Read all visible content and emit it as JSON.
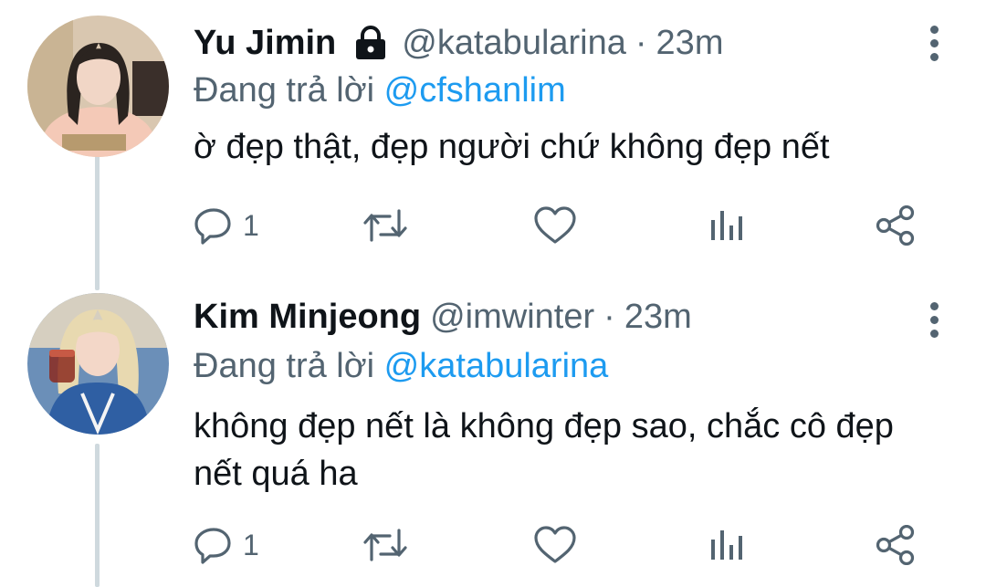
{
  "tweets": [
    {
      "name": "Yu Jimin",
      "handle": "@katabularina",
      "dot": "·",
      "time": "23m",
      "protected": true,
      "reply_prefix": "Đang trả lời",
      "reply_to": "@cfshanlim",
      "text": "ờ đẹp thật, đẹp người chứ không đẹp nết",
      "reply_count": "1",
      "avatar_colors": {
        "bg": "#d9c7b0",
        "hair": "#2b2420",
        "skin": "#f1d6c6",
        "shirt": "#f4c9b7"
      }
    },
    {
      "name": "Kim Minjeong",
      "handle": "@imwinter",
      "dot": "·",
      "time": "23m",
      "protected": false,
      "reply_prefix": "Đang trả lời",
      "reply_to": "@katabularina",
      "text": "không đẹp nết là không đẹp sao, chắc cô đẹp nết quá ha",
      "reply_count": "1",
      "avatar_colors": {
        "bg": "#6b8fb8",
        "hair": "#e8d9b0",
        "skin": "#f3d7c8",
        "shirt": "#2f5fa3"
      }
    }
  ],
  "icons": {
    "reply": "reply-icon",
    "retweet": "retweet-icon",
    "like": "heart-icon",
    "views": "analytics-icon",
    "share": "share-icon",
    "more": "more-vertical-icon",
    "lock": "lock-icon"
  },
  "colors": {
    "mention": "#1d9bf0",
    "secondary": "#536471",
    "thread_line": "#cfd9de"
  }
}
